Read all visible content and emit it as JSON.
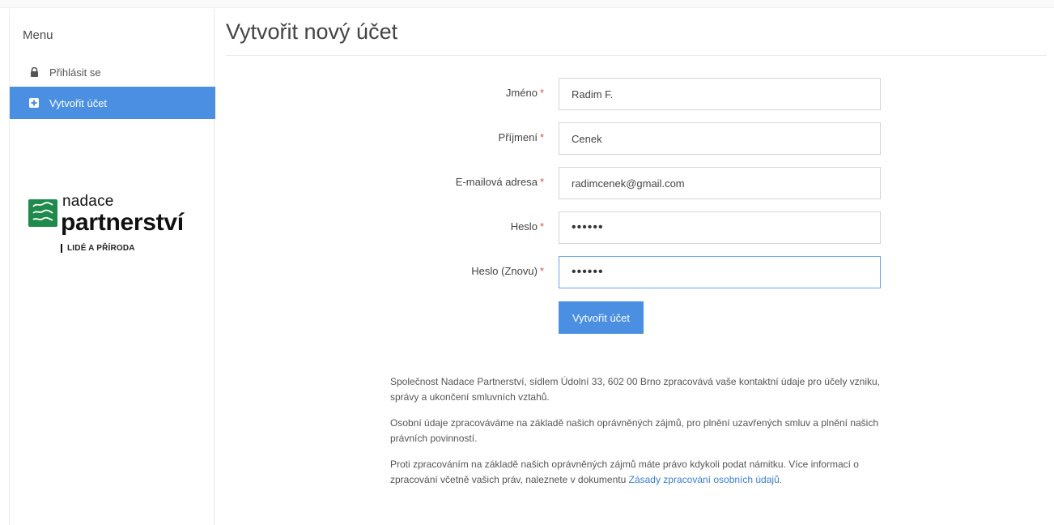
{
  "sidebar": {
    "menu_title": "Menu",
    "items": [
      {
        "label": "Přihlásit se",
        "icon": "lock-icon"
      },
      {
        "label": "Vytvořit účet",
        "icon": "plus-square-icon",
        "active": true
      }
    ],
    "logo": {
      "line1": "nadace",
      "line2": "partnerství",
      "tagline": "LIDÉ A PŘÍRODA"
    }
  },
  "main": {
    "title": "Vytvořit nový účet",
    "required_mark": "*",
    "fields": [
      {
        "label": "Jméno",
        "value": "Radim F."
      },
      {
        "label": "Příjmení",
        "value": "Cenek"
      },
      {
        "label": "E-mailová adresa",
        "value": "radimcenek@gmail.com"
      },
      {
        "label": "Heslo",
        "value": "••••••"
      },
      {
        "label": "Heslo (Znovu)",
        "value": "••••••"
      }
    ],
    "submit_label": "Vytvořit účet",
    "notice": {
      "p1": "Společnost Nadace Partnerství, sídlem Údolní 33, 602 00 Brno zpracovává vaše kontaktní údaje pro účely vzniku, správy a ukončení smluvních vztahů.",
      "p2": "Osobní údaje zpracováváme na základě našich oprávněných zájmů, pro plnění uzavřených smluv a plnění našich právních povinností.",
      "p3_text": "Proti zpracováním na základě našich oprávněných zájmů máte právo kdykoli podat námitku. Více informací o zpracování včetně vašich práv, naleznete v dokumentu",
      "p3_link": "Zásady zpracování osobních údajů",
      "p3_end": "."
    }
  },
  "colors": {
    "accent": "#4a8fe2",
    "required": "#d9534f",
    "link": "#3a7fd0"
  }
}
